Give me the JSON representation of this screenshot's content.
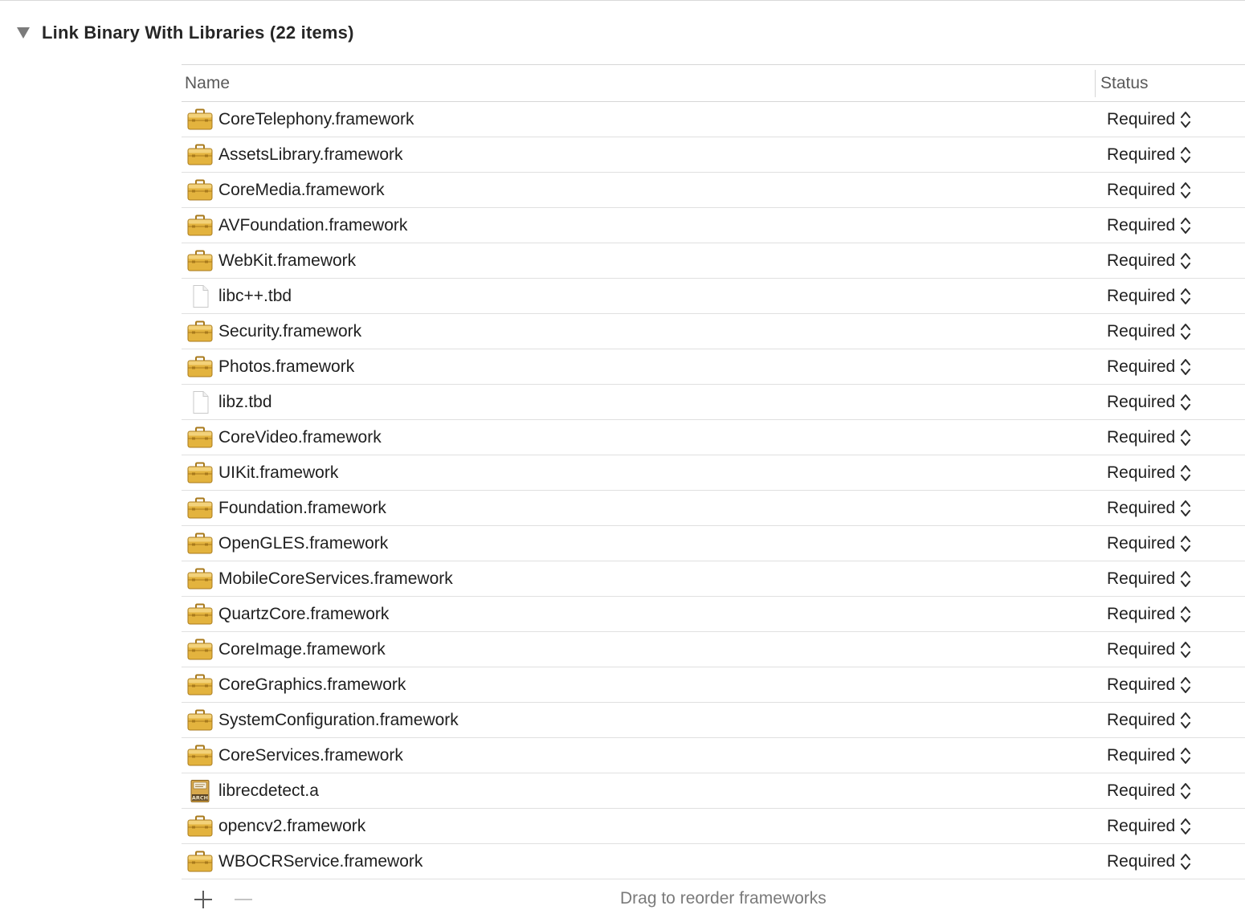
{
  "section": {
    "title": "Link Binary With Libraries (22 items)",
    "expanded": true,
    "disclosure_icon": "disclosure-triangle-down-icon"
  },
  "table": {
    "columns": {
      "name": "Name",
      "status": "Status"
    },
    "rows": [
      {
        "name": "CoreTelephony.framework",
        "status": "Required",
        "icon": "framework-toolbox-icon"
      },
      {
        "name": "AssetsLibrary.framework",
        "status": "Required",
        "icon": "framework-toolbox-icon"
      },
      {
        "name": "CoreMedia.framework",
        "status": "Required",
        "icon": "framework-toolbox-icon"
      },
      {
        "name": "AVFoundation.framework",
        "status": "Required",
        "icon": "framework-toolbox-icon"
      },
      {
        "name": "WebKit.framework",
        "status": "Required",
        "icon": "framework-toolbox-icon"
      },
      {
        "name": "libc++.tbd",
        "status": "Required",
        "icon": "document-file-icon"
      },
      {
        "name": "Security.framework",
        "status": "Required",
        "icon": "framework-toolbox-icon"
      },
      {
        "name": "Photos.framework",
        "status": "Required",
        "icon": "framework-toolbox-icon"
      },
      {
        "name": "libz.tbd",
        "status": "Required",
        "icon": "document-file-icon"
      },
      {
        "name": "CoreVideo.framework",
        "status": "Required",
        "icon": "framework-toolbox-icon"
      },
      {
        "name": "UIKit.framework",
        "status": "Required",
        "icon": "framework-toolbox-icon"
      },
      {
        "name": "Foundation.framework",
        "status": "Required",
        "icon": "framework-toolbox-icon"
      },
      {
        "name": "OpenGLES.framework",
        "status": "Required",
        "icon": "framework-toolbox-icon"
      },
      {
        "name": "MobileCoreServices.framework",
        "status": "Required",
        "icon": "framework-toolbox-icon"
      },
      {
        "name": "QuartzCore.framework",
        "status": "Required",
        "icon": "framework-toolbox-icon"
      },
      {
        "name": "CoreImage.framework",
        "status": "Required",
        "icon": "framework-toolbox-icon"
      },
      {
        "name": "CoreGraphics.framework",
        "status": "Required",
        "icon": "framework-toolbox-icon"
      },
      {
        "name": "SystemConfiguration.framework",
        "status": "Required",
        "icon": "framework-toolbox-icon"
      },
      {
        "name": "CoreServices.framework",
        "status": "Required",
        "icon": "framework-toolbox-icon"
      },
      {
        "name": "librecdetect.a",
        "status": "Required",
        "icon": "archive-library-icon",
        "icon_label": "ARCH"
      },
      {
        "name": "opencv2.framework",
        "status": "Required",
        "icon": "framework-toolbox-icon"
      },
      {
        "name": "WBOCRService.framework",
        "status": "Required",
        "icon": "framework-toolbox-icon"
      }
    ]
  },
  "footer": {
    "add_icon": "plus-icon",
    "remove_icon": "minus-icon",
    "hint": "Drag to reorder frameworks"
  },
  "colors": {
    "framework_icon": "#e3b33e",
    "framework_icon_dark": "#a87a1c",
    "divider": "#e0e0e0",
    "hint_text": "#7a7a7a"
  }
}
